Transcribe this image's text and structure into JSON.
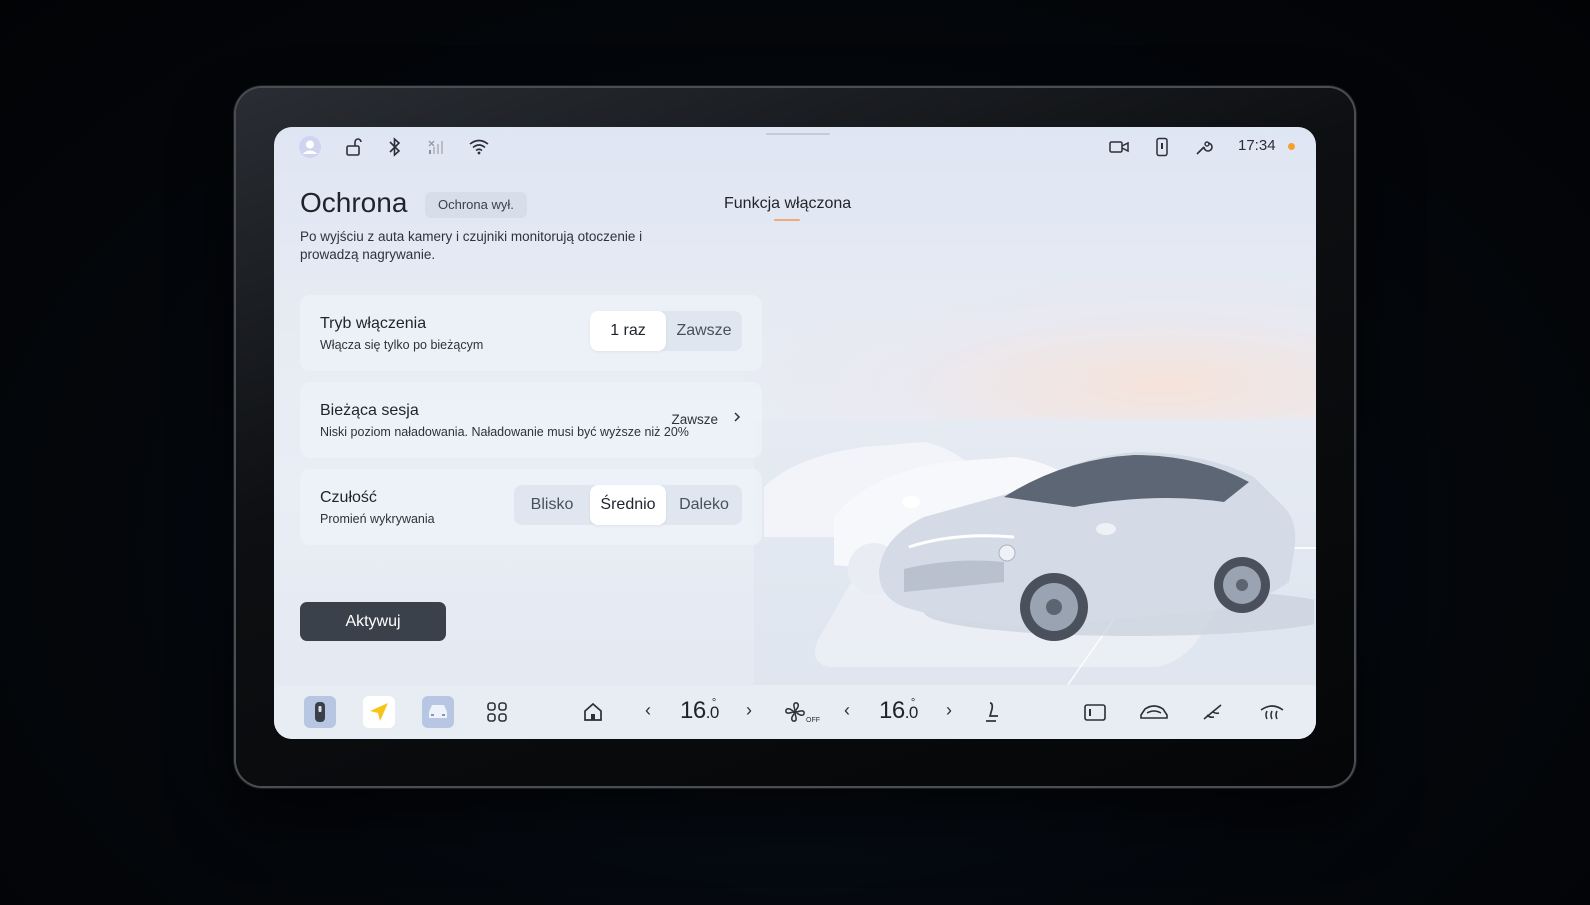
{
  "status_bar": {
    "time": "17:34",
    "icons": [
      "profile-icon",
      "unlock-icon",
      "bluetooth-icon",
      "cellular-icon",
      "wifi-icon",
      "dashcam-icon",
      "phone-key-icon",
      "wrench-icon"
    ]
  },
  "header": {
    "title": "Ochrona",
    "badge": "Ochrona wył.",
    "description": "Po wyjściu z auta kamery i czujniki monitorują otoczenie i prowadzą nagrywanie.",
    "function_status": "Funkcja włączona"
  },
  "settings": {
    "mode": {
      "title": "Tryb włączenia",
      "subtitle": "Włącza się tylko po bieżącym",
      "options": [
        "1 raz",
        "Zawsze"
      ],
      "selected": "1 raz"
    },
    "session": {
      "title": "Bieżąca sesja",
      "subtitle": "Niski poziom naładowania. Naładowanie musi być wyższe niż 20%",
      "value": "Zawsze"
    },
    "sensitivity": {
      "title": "Czułość",
      "subtitle": "Promień wykrywania",
      "options": [
        "Blisko",
        "Średnio",
        "Daleko"
      ],
      "selected": "Średnio"
    }
  },
  "activate_label": "Aktywuj",
  "dock": {
    "left_temp": "16",
    "left_temp_decimal": ".0",
    "right_temp": "16",
    "right_temp_decimal": ".0",
    "degree": "°",
    "fan_status": "OFF"
  },
  "colors": {
    "accent_orange": "#f5a02c",
    "button_dark": "#3b414b",
    "nav_yellow": "#f5c518"
  }
}
